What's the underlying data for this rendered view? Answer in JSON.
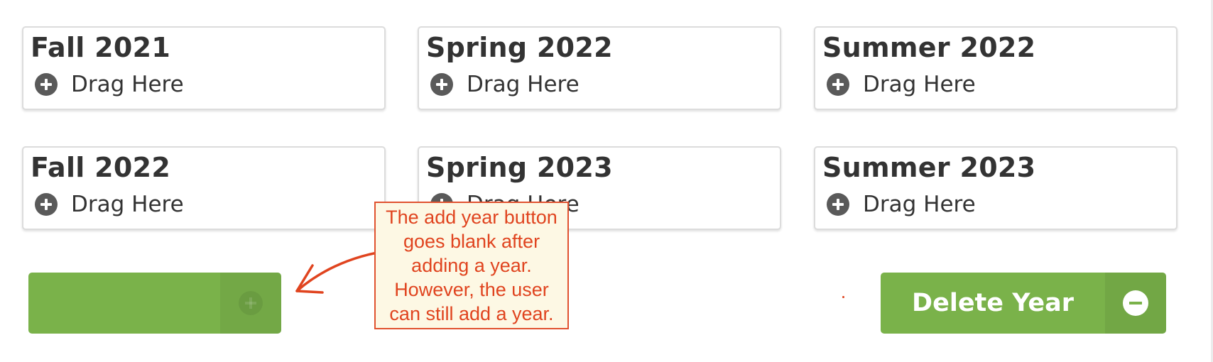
{
  "terms": [
    {
      "title": "Fall 2021",
      "drop_label": "Drag Here"
    },
    {
      "title": "Spring 2022",
      "drop_label": "Drag Here"
    },
    {
      "title": "Summer 2022",
      "drop_label": "Drag Here"
    },
    {
      "title": "Fall 2022",
      "drop_label": "Drag Here"
    },
    {
      "title": "Spring 2023",
      "drop_label": "Drag Here"
    },
    {
      "title": "Summer 2023",
      "drop_label": "Drag Here"
    }
  ],
  "buttons": {
    "add_year_label": "",
    "delete_year_label": "Delete Year"
  },
  "annotation": {
    "text": "The add year button goes blank after adding a year. However, the user can still add a year."
  },
  "icons": {
    "drop_zone": "plus-circle-icon",
    "add_button": "plus-circle-icon",
    "delete_button": "minus-circle-icon"
  },
  "colors": {
    "button_green": "#7ab24a",
    "annotation_red": "#e0441f",
    "annotation_bg": "#fdf8e4",
    "card_border": "#dcdcdc",
    "text_dark": "#333333"
  }
}
